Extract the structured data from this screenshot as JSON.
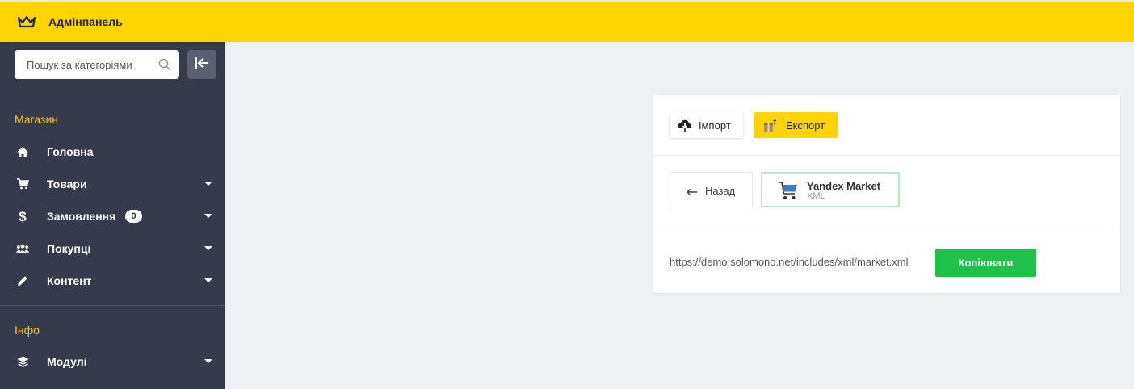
{
  "header": {
    "title": "Адмінпанель",
    "logo_icon": "crown-icon",
    "background": "#ffd400"
  },
  "sidebar": {
    "search": {
      "placeholder": "Пошук за категоріями",
      "value": ""
    },
    "collapse_icon": "collapse-left-icon",
    "sections": [
      {
        "label": "Магазин"
      },
      {
        "label": "Інфо"
      }
    ],
    "items": [
      {
        "label": "Головна",
        "icon": "home-icon",
        "has_caret": false
      },
      {
        "label": "Товари",
        "icon": "cart-icon",
        "has_caret": true
      },
      {
        "label": "Замовлення",
        "icon": "dollar-icon",
        "has_caret": true,
        "badge": "0"
      },
      {
        "label": "Покупці",
        "icon": "users-icon",
        "has_caret": true
      },
      {
        "label": "Контент",
        "icon": "pencil-icon",
        "has_caret": true
      },
      {
        "label": "Модулі",
        "icon": "layers-icon",
        "has_caret": true
      }
    ]
  },
  "main": {
    "tabs": [
      {
        "label": "Імпорт",
        "icon": "cloud-download-icon",
        "active": false
      },
      {
        "label": "Експорт",
        "icon": "box-icon",
        "active": true
      }
    ],
    "back_label": "Назад",
    "export_format": {
      "title": "Yandex Market",
      "subtitle": "XML",
      "icon": "shopping-cart-icon"
    },
    "url": "https://demo.solomono.net/includes/xml/market.xml",
    "copy_label": "Копіювати",
    "accent": "#1fc14a"
  }
}
